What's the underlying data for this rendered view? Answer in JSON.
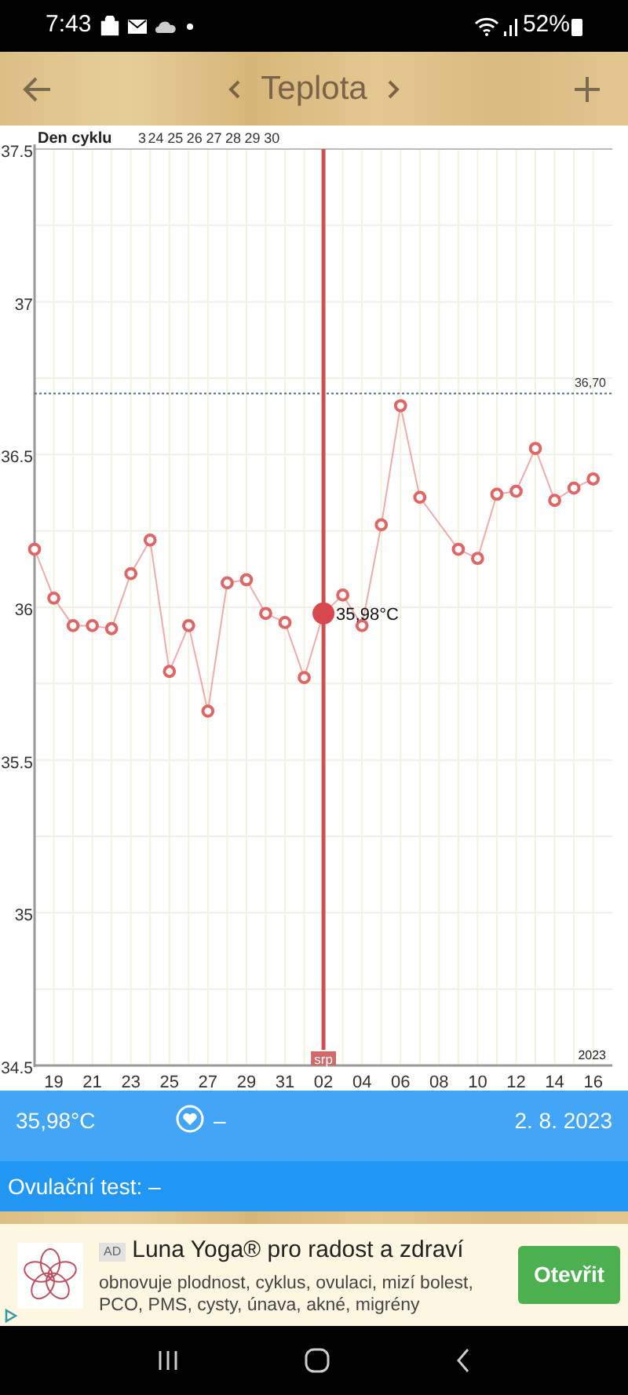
{
  "status_bar": {
    "time": "7:43",
    "battery": "52%"
  },
  "header": {
    "title": "Teplota"
  },
  "chart": {
    "cycle_label": "Den cyklu",
    "cycle_days": [
      "3",
      "24",
      "25",
      "26",
      "27",
      "28",
      "29",
      "30"
    ],
    "month_label": "srp",
    "year_label": "2023",
    "selected_label": "35,98°C",
    "chart_data": {
      "type": "line",
      "grid": true,
      "categories": [
        null,
        "19",
        null,
        "21",
        null,
        "23",
        null,
        "25",
        null,
        "27",
        null,
        "29",
        null,
        "31",
        null,
        "02",
        null,
        "04",
        null,
        "06",
        null,
        "08",
        null,
        "10",
        null,
        "12",
        null,
        "14",
        null,
        "16"
      ],
      "series": [
        {
          "color": "#e06666",
          "marker": "o",
          "values": [
            36.19,
            36.03,
            35.94,
            35.94,
            35.93,
            36.11,
            36.22,
            35.79,
            35.94,
            35.66,
            36.08,
            36.09,
            35.98,
            35.95,
            35.77,
            35.98,
            36.04,
            35.94,
            36.27,
            36.66,
            36.36,
            null,
            36.19,
            36.16,
            36.37,
            36.38,
            36.52,
            36.35,
            36.39,
            36.42
          ]
        }
      ],
      "ylim": [
        34.5,
        37.5
      ],
      "yticks": [
        34.5,
        35,
        35.5,
        36,
        36.5,
        37,
        37.5
      ],
      "ref_lines": [
        {
          "axis": "y",
          "value": 36.7,
          "label": "36,70",
          "color": "#4a6a8a"
        },
        {
          "axis": "x",
          "value": "02",
          "color": "#d05050"
        }
      ]
    }
  },
  "info": {
    "temperature": "35,98°C",
    "heart_value": "–",
    "date": "2. 8. 2023",
    "ovulation": "Ovulační test: –"
  },
  "ad": {
    "badge": "AD",
    "title": "Luna Yoga® pro radost a zdraví",
    "text": "obnovuje plodnost, cyklus, ovulaci, mizí bolest, PCO, PMS, cysty, únava, akné, migrény",
    "button": "Otevřit"
  }
}
